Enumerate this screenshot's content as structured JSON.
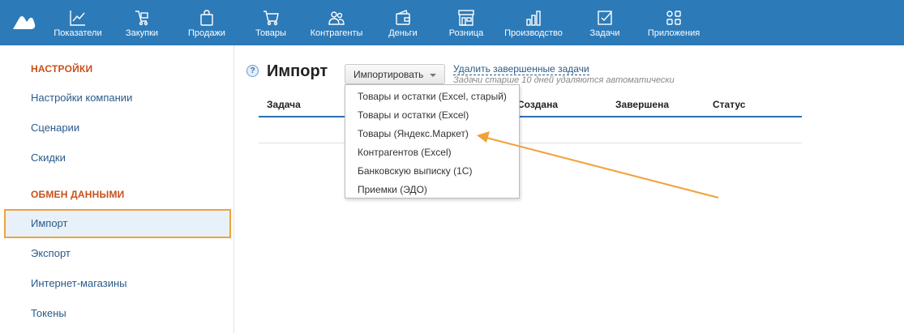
{
  "nav": {
    "items": [
      {
        "label": "Показатели",
        "icon": "chart-icon"
      },
      {
        "label": "Закупки",
        "icon": "cart-hand-icon"
      },
      {
        "label": "Продажи",
        "icon": "bag-icon"
      },
      {
        "label": "Товары",
        "icon": "cart-icon"
      },
      {
        "label": "Контрагенты",
        "icon": "people-icon"
      },
      {
        "label": "Деньги",
        "icon": "wallet-icon"
      },
      {
        "label": "Розница",
        "icon": "store-icon"
      },
      {
        "label": "Производство",
        "icon": "factory-icon"
      },
      {
        "label": "Задачи",
        "icon": "task-check-icon"
      },
      {
        "label": "Приложения",
        "icon": "apps-icon"
      }
    ]
  },
  "sidebar": {
    "section1": "НАСТРОЙКИ",
    "settings_items": [
      "Настройки компании",
      "Сценарии",
      "Скидки"
    ],
    "section2": "ОБМЕН ДАННЫМИ",
    "exchange_items": [
      "Импорт",
      "Экспорт",
      "Интернет-магазины",
      "Токены"
    ],
    "active": "Импорт"
  },
  "main": {
    "title": "Импорт",
    "help": "?",
    "import_button": "Импортировать",
    "delete_link": "Удалить завершенные задачи",
    "delete_note": "Задачи старше 10 дней удаляются автоматически",
    "columns": [
      "Задача",
      "Создана",
      "Завершена",
      "Статус"
    ]
  },
  "dropdown": {
    "items": [
      "Товары и остатки (Excel, старый)",
      "Товары и остатки (Excel)",
      "Товары (Яндекс.Маркет)",
      "Контрагентов (Excel)",
      "Банковскую выписку (1С)",
      "Приемки (ЭДО)"
    ]
  },
  "colors": {
    "topbar": "#2d7ab8",
    "section_heading": "#c8511b",
    "link": "#2a5a8a",
    "highlight": "#f0a23a"
  }
}
